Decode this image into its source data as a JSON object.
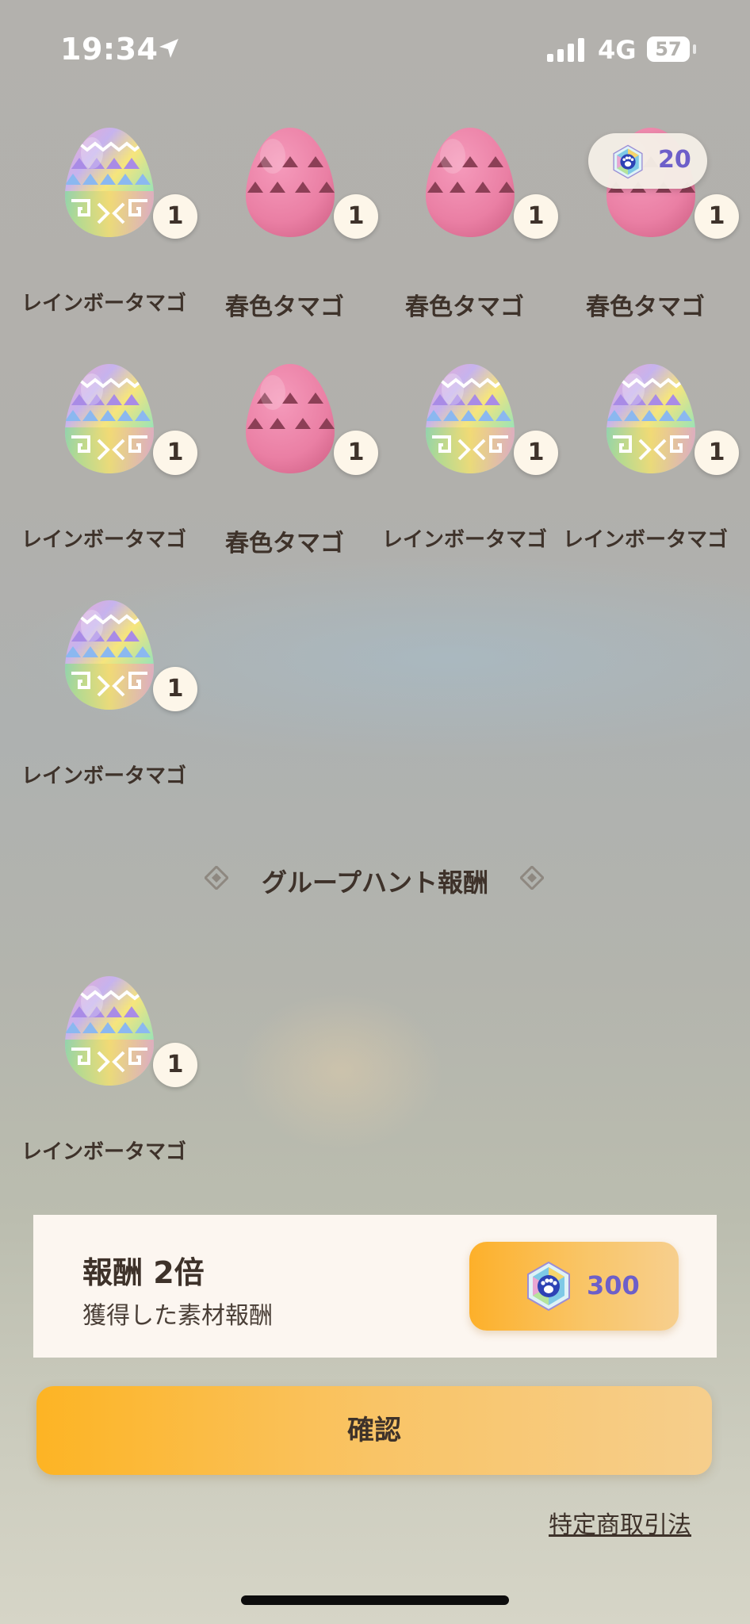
{
  "status_bar": {
    "time": "19:34",
    "network": "4G",
    "battery": "57"
  },
  "eggs": [
    {
      "name": "レインボータマゴ",
      "kind": "rainbow",
      "count": "1"
    },
    {
      "name": "春色タマゴ",
      "kind": "spring",
      "count": "1"
    },
    {
      "name": "春色タマゴ",
      "kind": "spring",
      "count": "1"
    },
    {
      "name": "春色タマゴ",
      "kind": "spring",
      "count": "1"
    },
    {
      "name": "レインボータマゴ",
      "kind": "rainbow",
      "count": "1"
    },
    {
      "name": "春色タマゴ",
      "kind": "spring",
      "count": "1"
    },
    {
      "name": "レインボータマゴ",
      "kind": "rainbow",
      "count": "1"
    },
    {
      "name": "レインボータマゴ",
      "kind": "rainbow",
      "count": "1"
    },
    {
      "name": "レインボータマゴ",
      "kind": "rainbow",
      "count": "1"
    }
  ],
  "gem_badge": {
    "value": "20",
    "icon": "paw-gem-icon"
  },
  "group_hunt": {
    "title": "グループハント報酬",
    "eggs": [
      {
        "name": "レインボータマゴ",
        "kind": "rainbow",
        "count": "1"
      }
    ]
  },
  "reward_panel": {
    "title": "報酬 2倍",
    "subtitle": "獲得した素材報酬",
    "button_value": "300",
    "button_icon": "paw-gem-icon"
  },
  "confirm_label": "確認",
  "legal_link": "特定商取引法",
  "colors": {
    "accent_orange": "#fdb02a",
    "gem_text": "#6d5fc9",
    "panel_bg": "#fcf6f0"
  }
}
